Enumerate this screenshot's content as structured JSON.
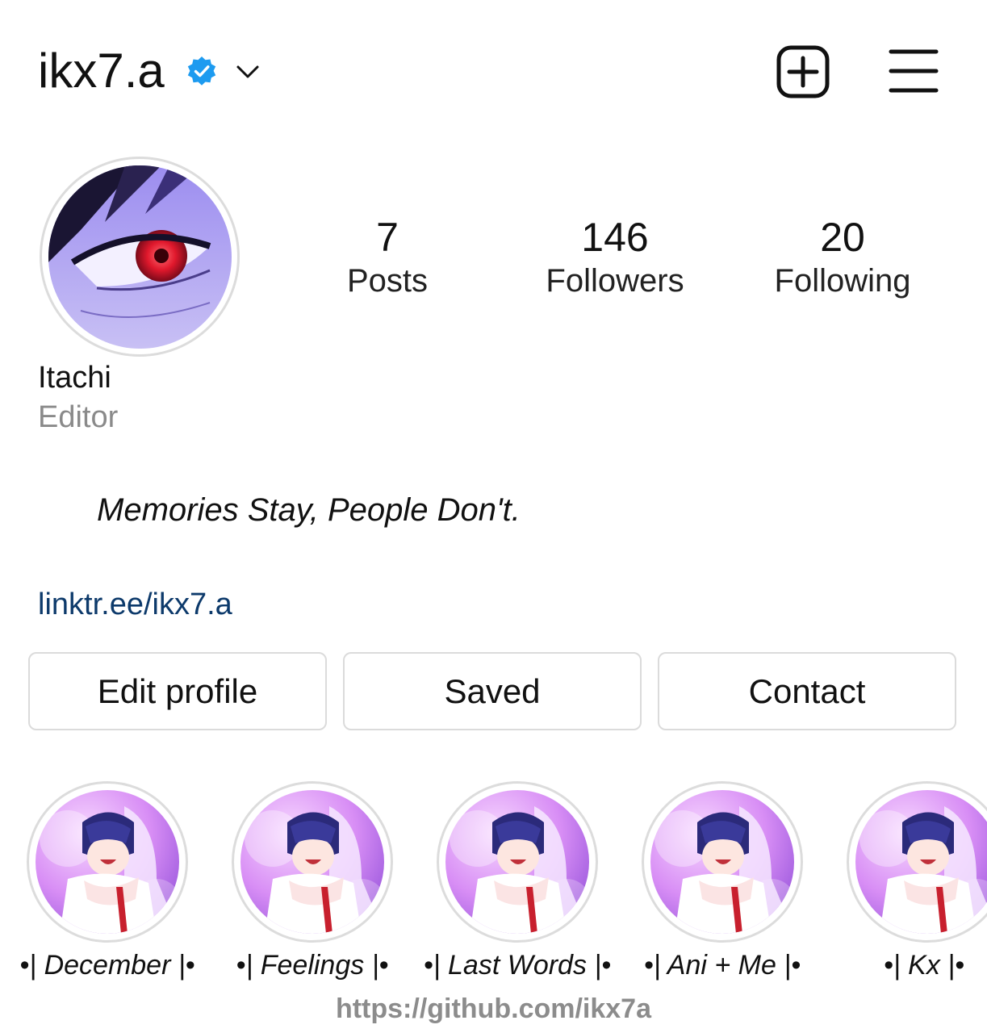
{
  "header": {
    "username": "ikx7.a",
    "icons": [
      "verified-badge-icon",
      "chevron-down-icon",
      "new-post-icon",
      "menu-icon"
    ]
  },
  "stats": [
    {
      "count": "7",
      "label": "Posts"
    },
    {
      "count": "146",
      "label": "Followers"
    },
    {
      "count": "20",
      "label": "Following"
    }
  ],
  "profile": {
    "display_name": "Itachi",
    "category": "Editor",
    "bio": "Memories Stay, People Don't.",
    "link": "linktr.ee/ikx7.a"
  },
  "actions": {
    "edit_profile": "Edit profile",
    "saved": "Saved",
    "contact": "Contact"
  },
  "highlights": [
    {
      "label": "•| December |•"
    },
    {
      "label": "•| Feelings |•"
    },
    {
      "label": "•| Last Words |•"
    },
    {
      "label": "•| Ani + Me |•"
    },
    {
      "label": "•| Kx |•"
    }
  ],
  "watermark": "https://github.com/ikx7a",
  "colors": {
    "verified": "#1d9bf0",
    "link": "#0d3a6b",
    "secondary_text": "#8a8a8a",
    "button_border": "#dbdbdb"
  }
}
